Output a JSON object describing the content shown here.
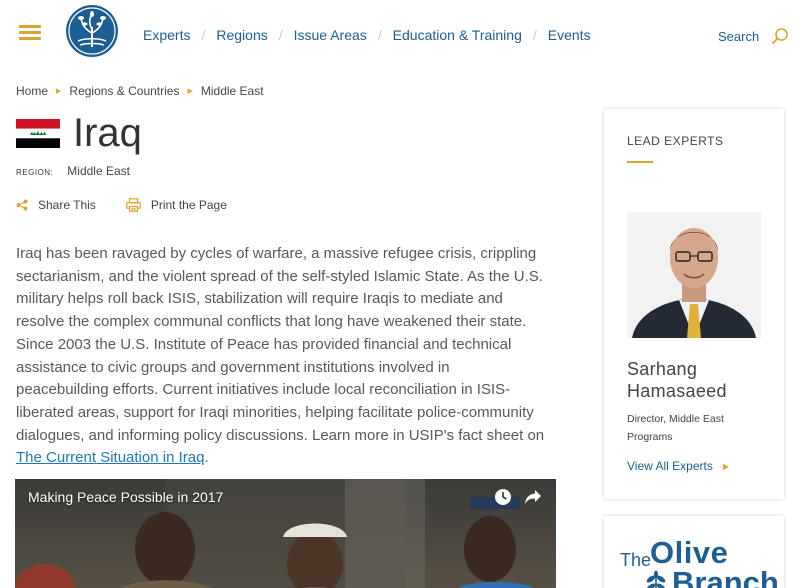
{
  "header": {
    "nav": [
      "Experts",
      "Regions",
      "Issue Areas",
      "Education & Training",
      "Events"
    ],
    "search_label": "Search"
  },
  "breadcrumb": [
    "Home",
    "Regions & Countries",
    "Middle East"
  ],
  "page": {
    "title": "Iraq",
    "region_label": "REGION:",
    "region_value": "Middle East",
    "share_label": "Share This",
    "print_label": "Print the Page",
    "body_before_link": "Iraq has been ravaged by cycles of warfare, a massive refugee crisis, crippling sectarianism, and the violent spread of the self-styled Islamic State. As the U.S. military helps roll back ISIS, stabilization will require Iraqis to mediate and resolve the complex communal conflicts that long have weakened their state. Since 2003 the U.S. Institute of Peace has provided financial and technical assistance to civic groups and government institutions involved in peacebuilding efforts. Current initiatives include local reconciliation in ISIS-liberated areas, support for Iraqi minorities, helping facilitate police-community dialogues, and informing policy discussions. Learn more in USIP's fact sheet on ",
    "body_link": "The Current Situation in Iraq",
    "body_after_link": "."
  },
  "video": {
    "title": "Making Peace Possible in 2017",
    "icons": [
      "clock-icon",
      "share-arrow-icon"
    ]
  },
  "sidebar": {
    "heading": "LEAD EXPERTS",
    "expert_name_line1": "Sarhang",
    "expert_name_line2": "Hamasaeed",
    "expert_role_line1": "Director, Middle East",
    "expert_role_line2": "Programs",
    "view_all": "View All Experts"
  },
  "promo": {
    "word_the": "The",
    "word_olive": "Olive",
    "word_branch": "Branch"
  },
  "colors": {
    "brand_blue": "#1d5e94",
    "accent_gold": "#d9a530",
    "link_blue": "#1d78b8"
  }
}
